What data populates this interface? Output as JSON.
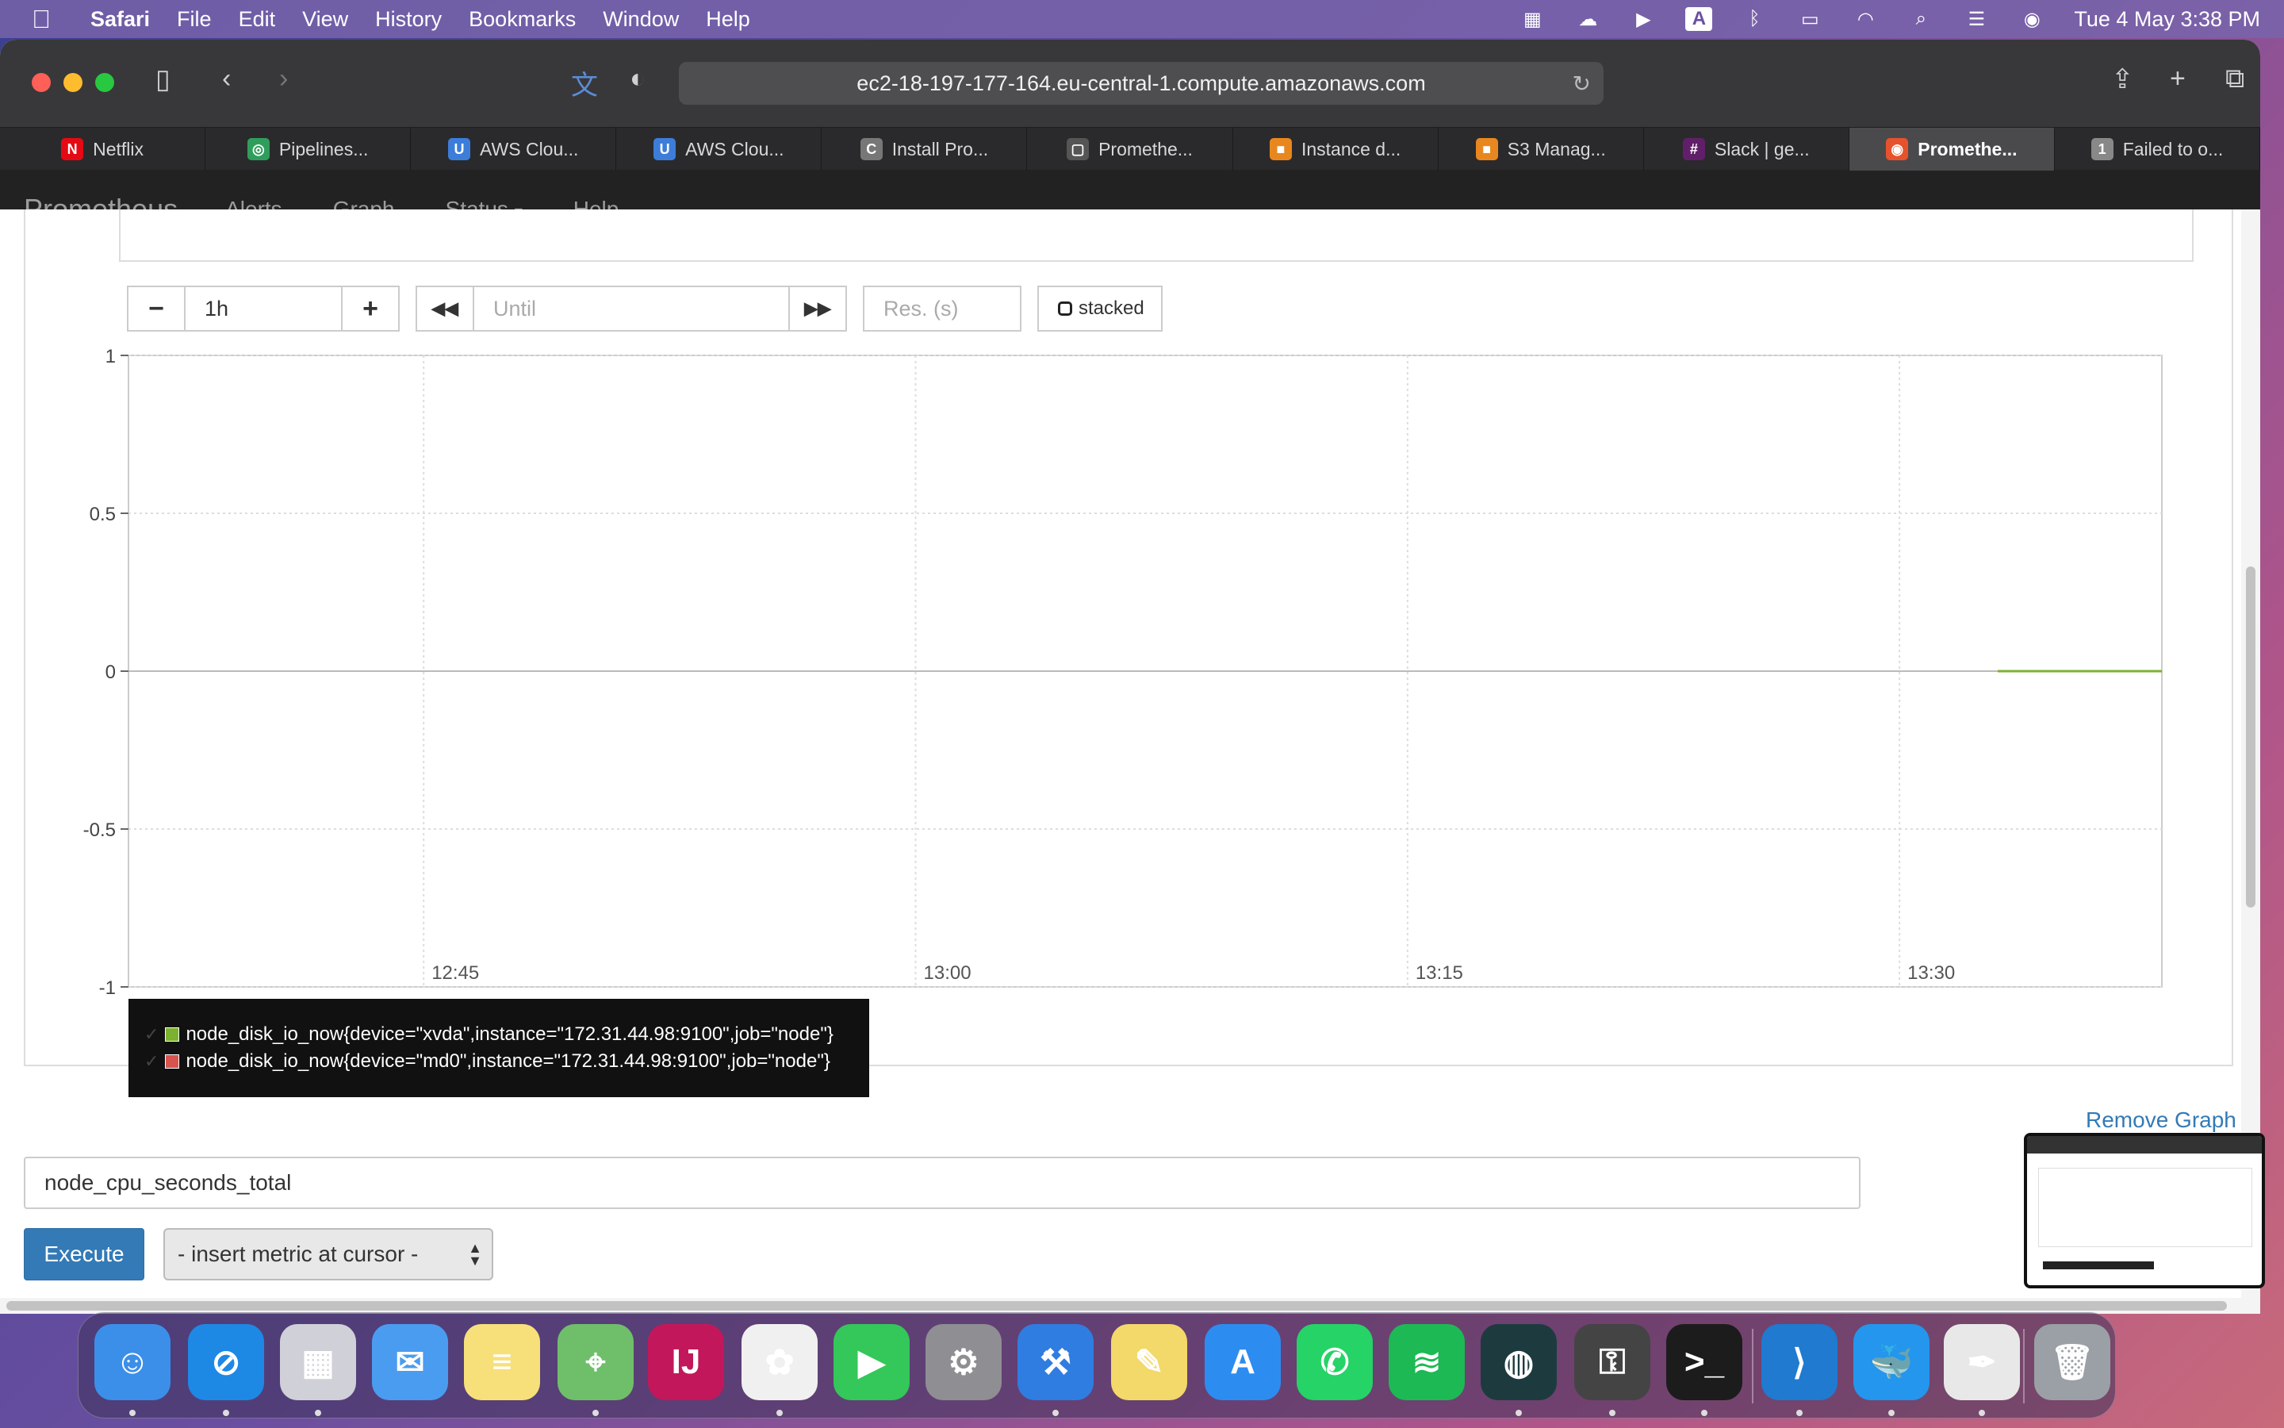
{
  "menubar": {
    "app_name": "Safari",
    "items": [
      "File",
      "Edit",
      "View",
      "History",
      "Bookmarks",
      "Window",
      "Help"
    ],
    "clock": "Tue 4 May  3:38 PM",
    "status_icons": [
      "docker-icon",
      "cloud-icon",
      "play-icon",
      "keyboard-a-icon",
      "bluetooth-icon",
      "battery-icon",
      "wifi-icon",
      "spotlight-search-icon",
      "control-center-icon",
      "siri-icon"
    ]
  },
  "browser": {
    "url": "ec2-18-197-177-164.eu-central-1.compute.amazonaws.com",
    "tabs": [
      {
        "label": "Netflix",
        "icon": "netflix-icon",
        "color": "#e50914",
        "glyph": "N"
      },
      {
        "label": "Pipelines...",
        "icon": "pipelines-icon",
        "color": "#2f9e5c",
        "glyph": "◎"
      },
      {
        "label": "AWS Clou...",
        "icon": "aws-cloud-icon",
        "color": "#3c7dd9",
        "glyph": "U"
      },
      {
        "label": "AWS Clou...",
        "icon": "aws-cloud-icon",
        "color": "#3c7dd9",
        "glyph": "U"
      },
      {
        "label": "Install Pro...",
        "icon": "c-icon",
        "color": "#777777",
        "glyph": "C"
      },
      {
        "label": "Promethe...",
        "icon": "page-icon",
        "color": "#555555",
        "glyph": "▢"
      },
      {
        "label": "Instance d...",
        "icon": "aws-box-icon",
        "color": "#e8871e",
        "glyph": "■"
      },
      {
        "label": "S3 Manag...",
        "icon": "aws-box-icon",
        "color": "#e8871e",
        "glyph": "■"
      },
      {
        "label": "Slack | ge...",
        "icon": "slack-icon",
        "color": "#611f69",
        "glyph": "#"
      },
      {
        "label": "Promethe...",
        "icon": "prometheus-icon",
        "color": "#e6522c",
        "glyph": "◉",
        "active": true
      },
      {
        "label": "Failed to o...",
        "icon": "one-icon",
        "color": "#888888",
        "glyph": "1"
      }
    ]
  },
  "prometheus": {
    "brand": "Prometheus",
    "nav": [
      "Alerts",
      "Graph",
      "Status",
      "Help"
    ],
    "status_caret": "▾"
  },
  "graph_controls": {
    "minus": "−",
    "range": "1h",
    "plus": "+",
    "back": "◀◀",
    "until_placeholder": "Until",
    "forward": "▶▶",
    "res_placeholder": "Res. (s)",
    "stacked_label": "stacked"
  },
  "chart_data": {
    "type": "line",
    "y_ticks": [
      "1",
      "0.5",
      "0",
      "-0.5",
      "-1"
    ],
    "y_values": [
      1,
      0.5,
      0,
      -0.5,
      -1
    ],
    "x_ticks": [
      "12:45",
      "13:00",
      "13:15",
      "13:30"
    ],
    "ylim": [
      -1,
      1
    ],
    "series": [
      {
        "name": "node_disk_io_now{device=\"xvda\",instance=\"172.31.44.98:9100\",job=\"node\"}",
        "color": "#7bb22f",
        "x": [
          "13:33",
          "13:38"
        ],
        "values": [
          0,
          0
        ]
      },
      {
        "name": "node_disk_io_now{device=\"md0\",instance=\"172.31.44.98:9100\",job=\"node\"}",
        "color": "#d9534f",
        "x": [
          "13:33",
          "13:38"
        ],
        "values": [
          0,
          0
        ]
      }
    ]
  },
  "legend": {
    "check": "✓",
    "items": [
      "node_disk_io_now{device=\"xvda\",instance=\"172.31.44.98:9100\",job=\"node\"}",
      "node_disk_io_now{device=\"md0\",instance=\"172.31.44.98:9100\",job=\"node\"}"
    ],
    "colors": [
      "#7bb22f",
      "#d9534f"
    ]
  },
  "panel": {
    "remove_graph": "Remove Graph",
    "expression": "node_cpu_seconds_total",
    "execute": "Execute",
    "insert_metric": "- insert metric at cursor -"
  },
  "dock": {
    "apps": [
      {
        "name": "finder-icon",
        "color": "#3b8fe8",
        "glyph": "☺"
      },
      {
        "name": "safari-icon",
        "color": "#1e88e5",
        "glyph": "⊘"
      },
      {
        "name": "launchpad-icon",
        "color": "#d0d0d8",
        "glyph": "▦"
      },
      {
        "name": "mail-icon",
        "color": "#4a9cf0",
        "glyph": "✉"
      },
      {
        "name": "notes-icon",
        "color": "#f7e07a",
        "glyph": "≡"
      },
      {
        "name": "maps-icon",
        "color": "#6fbf6a",
        "glyph": "⌖"
      },
      {
        "name": "intellij-icon",
        "color": "#c2185b",
        "glyph": "IJ"
      },
      {
        "name": "photos-icon",
        "color": "#f0f0f0",
        "glyph": "✿"
      },
      {
        "name": "facetime-icon",
        "color": "#34c759",
        "glyph": "▶"
      },
      {
        "name": "system-preferences-icon",
        "color": "#8e8e93",
        "glyph": "⚙"
      },
      {
        "name": "xcode-icon",
        "color": "#2f7de1",
        "glyph": "⚒"
      },
      {
        "name": "stickies-icon",
        "color": "#f3d86a",
        "glyph": "✎"
      },
      {
        "name": "app-store-icon",
        "color": "#2d8cf0",
        "glyph": "A"
      },
      {
        "name": "whatsapp-icon",
        "color": "#25d366",
        "glyph": "✆"
      },
      {
        "name": "spotify-icon",
        "color": "#1db954",
        "glyph": "≋"
      },
      {
        "name": "gitkraken-icon",
        "color": "#1d3b3f",
        "glyph": "◍"
      },
      {
        "name": "keychain-icon",
        "color": "#444444",
        "glyph": "⚿"
      },
      {
        "name": "terminal-icon",
        "color": "#1c1c1c",
        "glyph": ">_"
      },
      {
        "name": "vscode-icon",
        "color": "#1f7ad0",
        "glyph": "⟩"
      },
      {
        "name": "docker-icon",
        "color": "#2496ed",
        "glyph": "🐳"
      },
      {
        "name": "textedit-icon",
        "color": "#e8e8e8",
        "glyph": "✒"
      },
      {
        "name": "trash-icon",
        "color": "#9aa0a6",
        "glyph": "🗑"
      }
    ]
  }
}
